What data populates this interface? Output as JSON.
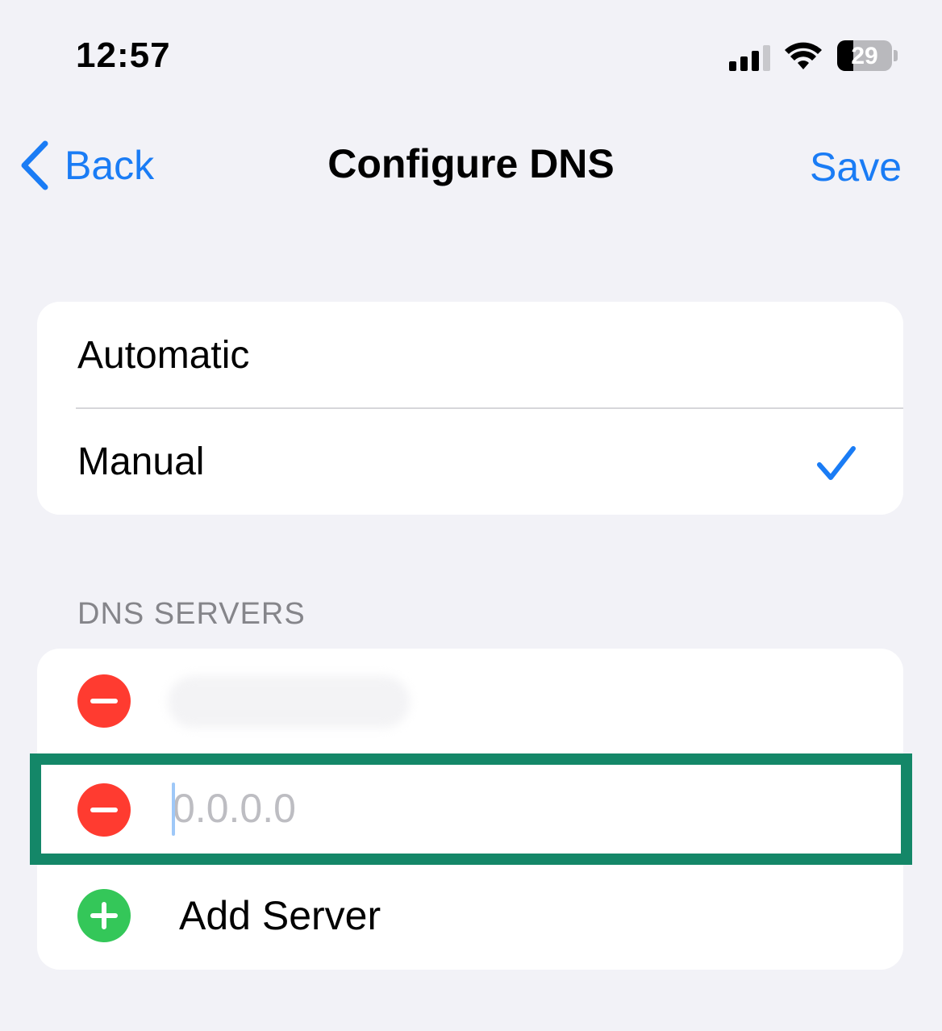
{
  "status_bar": {
    "time": "12:57",
    "battery_level": "29",
    "battery_fraction": 0.29,
    "icons": [
      "cellular-signal-icon",
      "wifi-icon",
      "battery-icon"
    ]
  },
  "nav": {
    "back_label": "Back",
    "title": "Configure DNS",
    "save_label": "Save"
  },
  "dns_mode": {
    "options": [
      {
        "label": "Automatic",
        "selected": false
      },
      {
        "label": "Manual",
        "selected": true
      }
    ]
  },
  "dns_servers": {
    "header": "DNS SERVERS",
    "servers": [
      {
        "value": "",
        "redacted": true
      },
      {
        "value": "",
        "placeholder": "0.0.0.0",
        "focused": true
      }
    ],
    "add_label": "Add Server"
  },
  "colors": {
    "accent": "#1a7cf5",
    "delete": "#ff3b30",
    "add": "#34c759",
    "highlight": "#148768",
    "background": "#f2f2f7"
  }
}
